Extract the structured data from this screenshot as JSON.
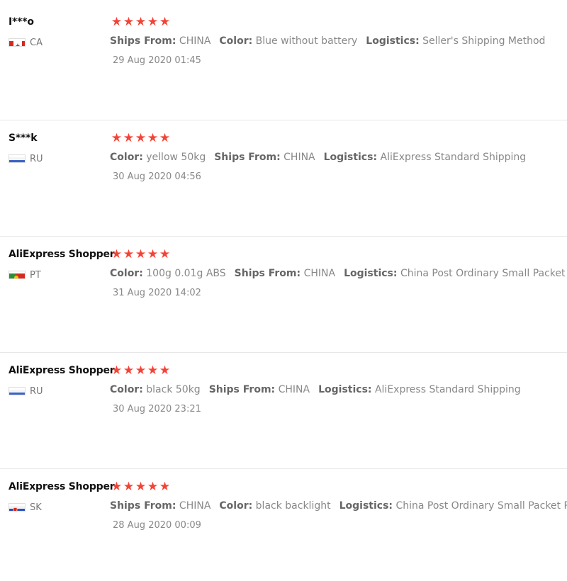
{
  "reviews": [
    {
      "user": "I***o",
      "country_code": "CA",
      "flag": "canada-flag",
      "rating": 5,
      "attributes": [
        {
          "label": "Ships From:",
          "value": "CHINA"
        },
        {
          "label": "Color:",
          "value": "Blue without battery"
        },
        {
          "label": "Logistics:",
          "value": "Seller's Shipping Method"
        }
      ],
      "date": "29 Aug 2020 01:45"
    },
    {
      "user": "S***k",
      "country_code": "RU",
      "flag": "russia-flag",
      "rating": 5,
      "attributes": [
        {
          "label": "Color:",
          "value": "yellow 50kg"
        },
        {
          "label": "Ships From:",
          "value": "CHINA"
        },
        {
          "label": "Logistics:",
          "value": "AliExpress Standard Shipping"
        }
      ],
      "date": "30 Aug 2020 04:56"
    },
    {
      "user": "AliExpress Shopper",
      "country_code": "PT",
      "flag": "portugal-flag",
      "rating": 5,
      "attributes": [
        {
          "label": "Color:",
          "value": "100g 0.01g ABS"
        },
        {
          "label": "Ships From:",
          "value": "CHINA"
        },
        {
          "label": "Logistics:",
          "value": "China Post Ordinary Small Packet Plus"
        }
      ],
      "date": "31 Aug 2020 14:02"
    },
    {
      "user": "AliExpress Shopper",
      "country_code": "RU",
      "flag": "russia-flag",
      "rating": 5,
      "attributes": [
        {
          "label": "Color:",
          "value": "black 50kg"
        },
        {
          "label": "Ships From:",
          "value": "CHINA"
        },
        {
          "label": "Logistics:",
          "value": "AliExpress Standard Shipping"
        }
      ],
      "date": "30 Aug 2020 23:21"
    },
    {
      "user": "AliExpress Shopper",
      "country_code": "SK",
      "flag": "slovakia-flag",
      "rating": 5,
      "attributes": [
        {
          "label": "Ships From:",
          "value": "CHINA"
        },
        {
          "label": "Color:",
          "value": "black backlight"
        },
        {
          "label": "Logistics:",
          "value": "China Post Ordinary Small Packet Plus"
        }
      ],
      "date": "28 Aug 2020 00:09"
    }
  ],
  "colors": {
    "star": "#f44336",
    "divider": "#e8e8e8",
    "text_muted": "#888888"
  }
}
